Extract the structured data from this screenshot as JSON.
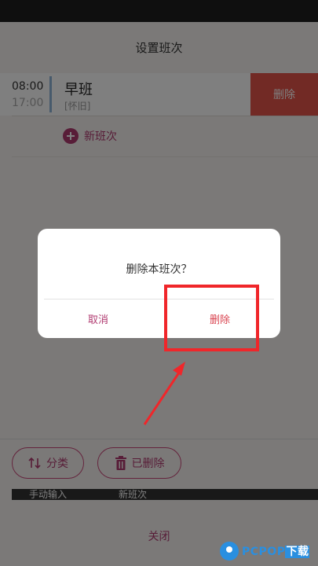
{
  "header": {
    "title": "设置班次"
  },
  "shift": {
    "start_time": "08:00",
    "end_time": "17:00",
    "name": "早班",
    "tag": "[怀旧]",
    "swipe_delete_label": "删除"
  },
  "new_shift_label": "新班次",
  "toolbar": {
    "sort_label": "分类",
    "deleted_label": "已删除"
  },
  "strip": {
    "left_text": "手动输入",
    "right_text": "新班次"
  },
  "close_label": "关闭",
  "dialog": {
    "message": "删除本班次？",
    "cancel_label": "取消",
    "confirm_label": "删除"
  },
  "watermark": {
    "text": "PCPOP",
    "suffix": "下载"
  },
  "colors": {
    "accent": "#b03a70",
    "delete_red": "#e5544a",
    "highlight_red": "#f0262a",
    "watermark_blue": "#2a8fe0"
  }
}
